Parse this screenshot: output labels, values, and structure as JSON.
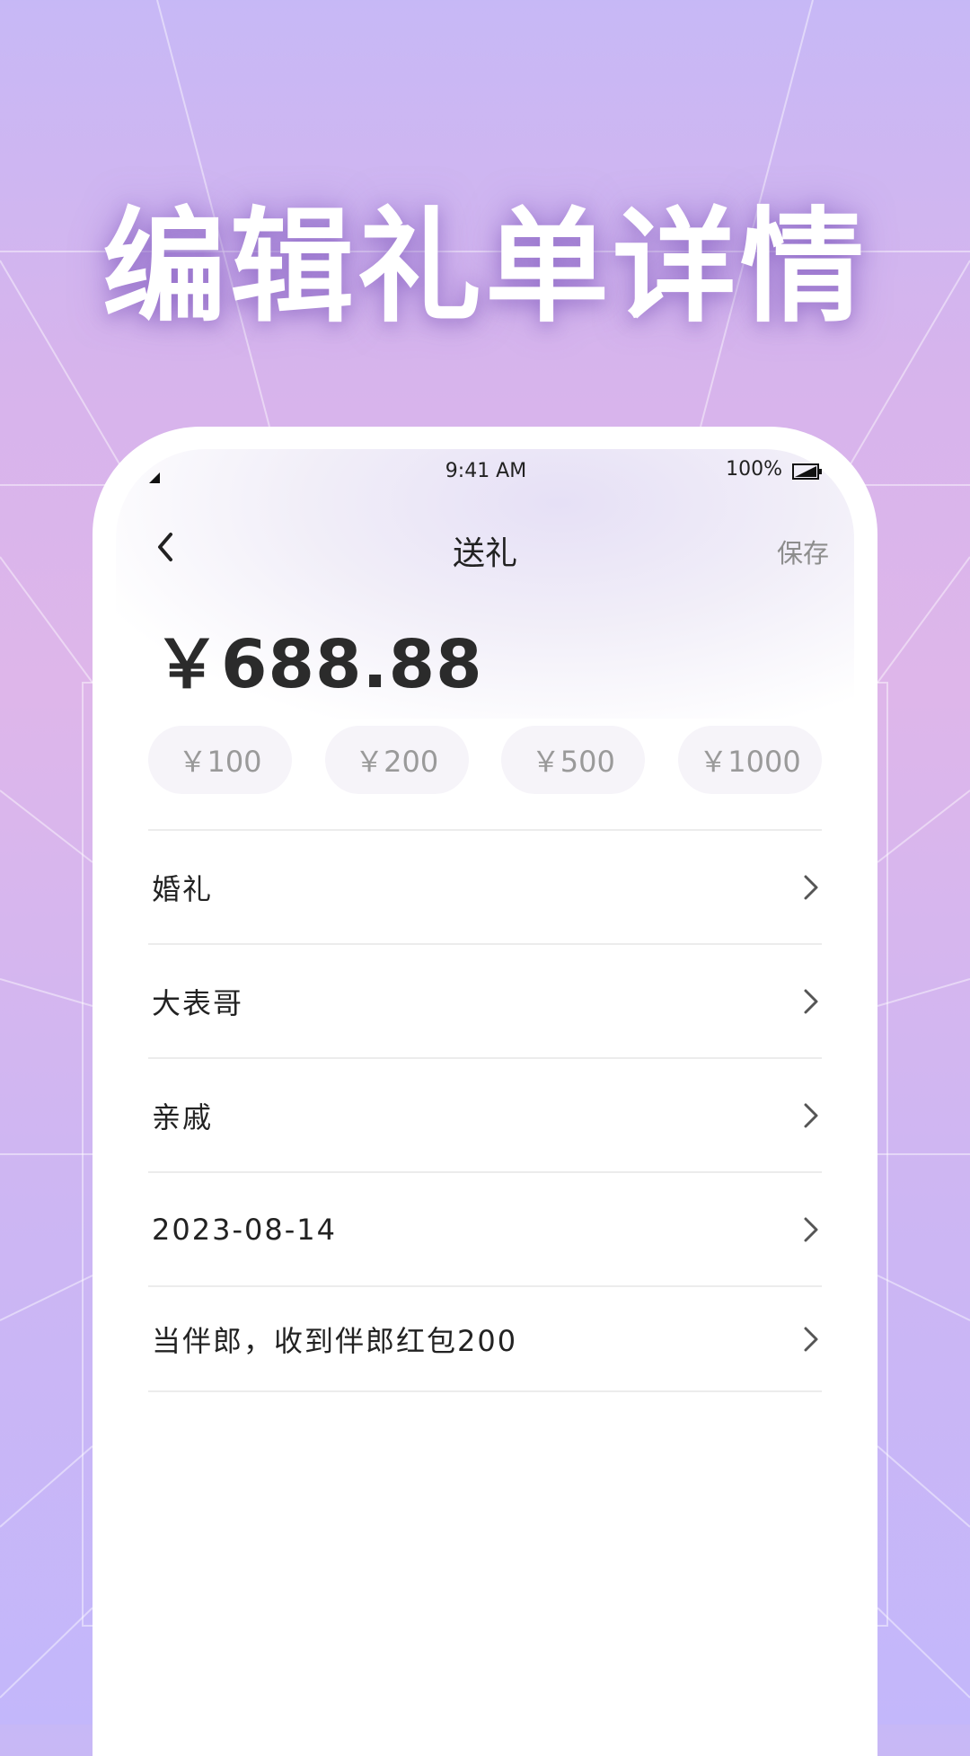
{
  "headline": "编辑礼单详情",
  "status_bar": {
    "time": "9:41 AM",
    "battery": "100%"
  },
  "nav": {
    "title": "送礼",
    "save_label": "保存"
  },
  "amount": "￥688.88",
  "quick_amounts": [
    "￥100",
    "￥200",
    "￥500",
    "￥1000"
  ],
  "fields": [
    {
      "label": "婚礼"
    },
    {
      "label": "大表哥"
    },
    {
      "label": "亲戚"
    },
    {
      "label": "2023-08-14"
    },
    {
      "label": "当伴郎，收到伴郎红包200"
    }
  ],
  "icons": {
    "back": "chevron-left-icon",
    "row_arrow": "chevron-right-icon",
    "signal": "signal-icon",
    "battery": "battery-icon"
  }
}
